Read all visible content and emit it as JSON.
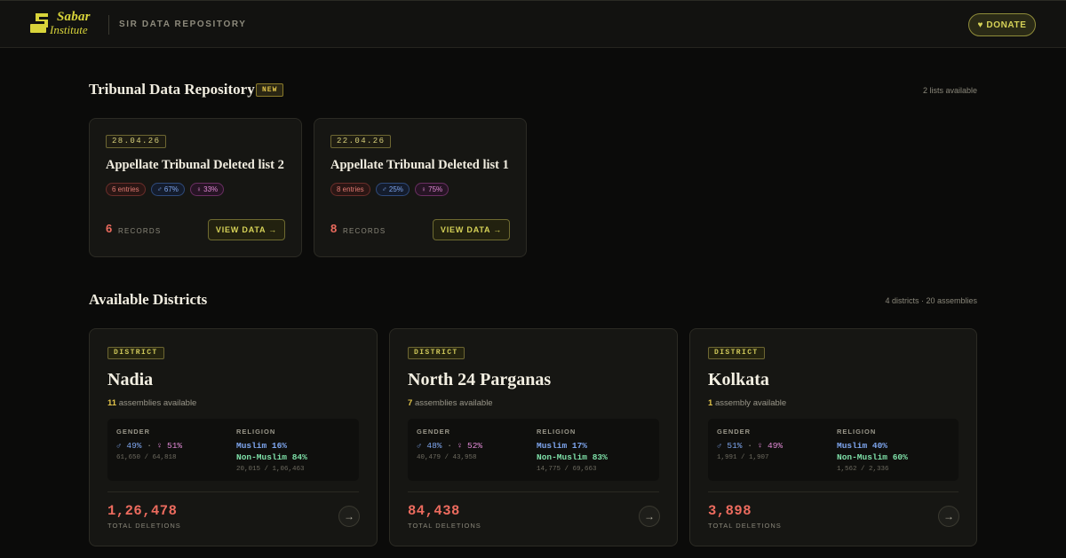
{
  "header": {
    "logo_line1": "Sabar",
    "logo_line2": "Institute",
    "title": "SIR DATA REPOSITORY",
    "donate_label": "♥ DONATE"
  },
  "tribunal": {
    "title": "Tribunal Data Repository",
    "badge": "NEW",
    "meta": "2 lists available",
    "cards": [
      {
        "date": "28.04.26",
        "title": "Appellate Tribunal Deleted list 2",
        "entries": "6 entries",
        "male": "♂ 67%",
        "female": "♀ 33%",
        "records": "6",
        "records_label": "RECORDS",
        "button": "VIEW DATA →"
      },
      {
        "date": "22.04.26",
        "title": "Appellate Tribunal Deleted list 1",
        "entries": "8 entries",
        "male": "♂ 25%",
        "female": "♀ 75%",
        "records": "8",
        "records_label": "RECORDS",
        "button": "VIEW DATA →"
      }
    ]
  },
  "districts": {
    "title": "Available Districts",
    "meta": "4 districts · 20 assemblies",
    "cards": [
      {
        "chip": "DISTRICT",
        "name": "Nadia",
        "assembly_count": "11",
        "assembly_text": "assemblies available",
        "gender_head": "GENDER",
        "male": "♂ 49%",
        "female": "♀ 51%",
        "gender_sub": "61,650 / 64,818",
        "religion_head": "RELIGION",
        "muslim": "Muslim 16%",
        "non_muslim": "Non-Muslim 84%",
        "religion_sub": "20,015 / 1,06,463",
        "total": "1,26,478",
        "total_label": "TOTAL DELETIONS"
      },
      {
        "chip": "DISTRICT",
        "name": "North 24 Parganas",
        "assembly_count": "7",
        "assembly_text": "assemblies available",
        "gender_head": "GENDER",
        "male": "♂ 48%",
        "female": "♀ 52%",
        "gender_sub": "40,479 / 43,958",
        "religion_head": "RELIGION",
        "muslim": "Muslim 17%",
        "non_muslim": "Non-Muslim 83%",
        "religion_sub": "14,775 / 69,663",
        "total": "84,438",
        "total_label": "TOTAL DELETIONS"
      },
      {
        "chip": "DISTRICT",
        "name": "Kolkata",
        "assembly_count": "1",
        "assembly_text": "assembly available",
        "gender_head": "GENDER",
        "male": "♂ 51%",
        "female": "♀ 49%",
        "gender_sub": "1,991 / 1,907",
        "religion_head": "RELIGION",
        "muslim": "Muslim 40%",
        "non_muslim": "Non-Muslim 60%",
        "religion_sub": "1,562 / 2,336",
        "total": "3,898",
        "total_label": "TOTAL DELETIONS"
      }
    ],
    "arrow": "→"
  },
  "colors": {
    "accent": "#d6d257",
    "danger": "#ec6b5e",
    "male": "#7ea6ef",
    "female": "#e28ad6",
    "non_muslim": "#7ee0a8"
  }
}
